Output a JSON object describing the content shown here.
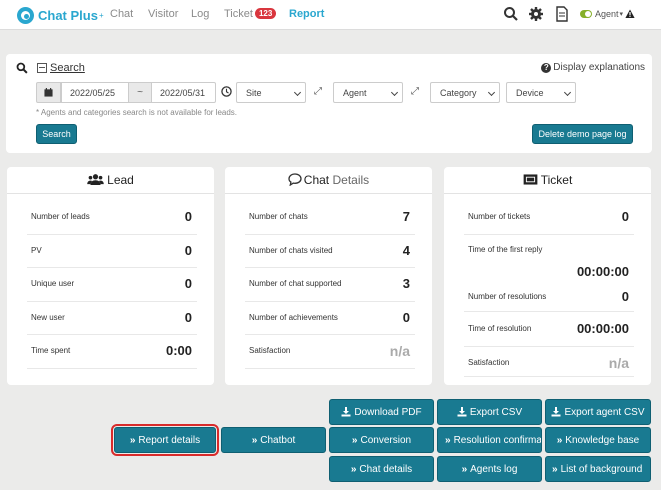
{
  "nav": {
    "logo": "Chat Plus",
    "logo_sup": "+",
    "items": [
      "Chat",
      "Visitor",
      "Log",
      "Ticket",
      "Report"
    ],
    "ticket_badge": "123",
    "agent": "Agent"
  },
  "search": {
    "link": "Search",
    "explain": "Display explanations",
    "date_from": "2022/05/25",
    "tilde": "~",
    "date_to": "2022/05/31",
    "selects": [
      "Site",
      "Agent",
      "Category",
      "Device"
    ],
    "note": "* Agents and categories search is not available for leads.",
    "search_button": "Search",
    "delete_button": "Delete demo page log"
  },
  "lead": {
    "title": "Lead",
    "rows": [
      {
        "label": "Number of leads",
        "value": "0"
      },
      {
        "label": "PV",
        "value": "0"
      },
      {
        "label": "Unique user",
        "value": "0"
      },
      {
        "label": "New user",
        "value": "0"
      },
      {
        "label": "Time spent",
        "value": "0:00"
      }
    ]
  },
  "chat": {
    "title_a": "Chat",
    "title_b": "Details",
    "rows": [
      {
        "label": "Number of chats",
        "value": "7"
      },
      {
        "label": "Number of chats visited",
        "value": "4"
      },
      {
        "label": "Number of chat supported",
        "value": "3"
      },
      {
        "label": "Number of achievements",
        "value": "0"
      },
      {
        "label": "Satisfaction",
        "value": "n/a"
      }
    ]
  },
  "ticket": {
    "title": "Ticket",
    "rows": [
      {
        "label": "Number of tickets",
        "value": "0"
      },
      {
        "label": "Time of the first reply",
        "value": "00:00:00"
      },
      {
        "label": "Number of resolutions",
        "value": "0"
      },
      {
        "label": "Time of resolution",
        "value": "00:00:00"
      },
      {
        "label": "Satisfaction",
        "value": "n/a"
      }
    ]
  },
  "buttons": {
    "download_pdf": "Download PDF",
    "export_csv": "Export CSV",
    "export_agent_csv": "Export agent CSV",
    "report_details": "Report details",
    "chatbot": "Chatbot",
    "conversion": "Conversion",
    "resolution": "Resolution confirma",
    "knowledge_base": "Knowledge base",
    "chat_details": "Chat details",
    "agents_log": "Agents log",
    "list_background": "List of background"
  }
}
